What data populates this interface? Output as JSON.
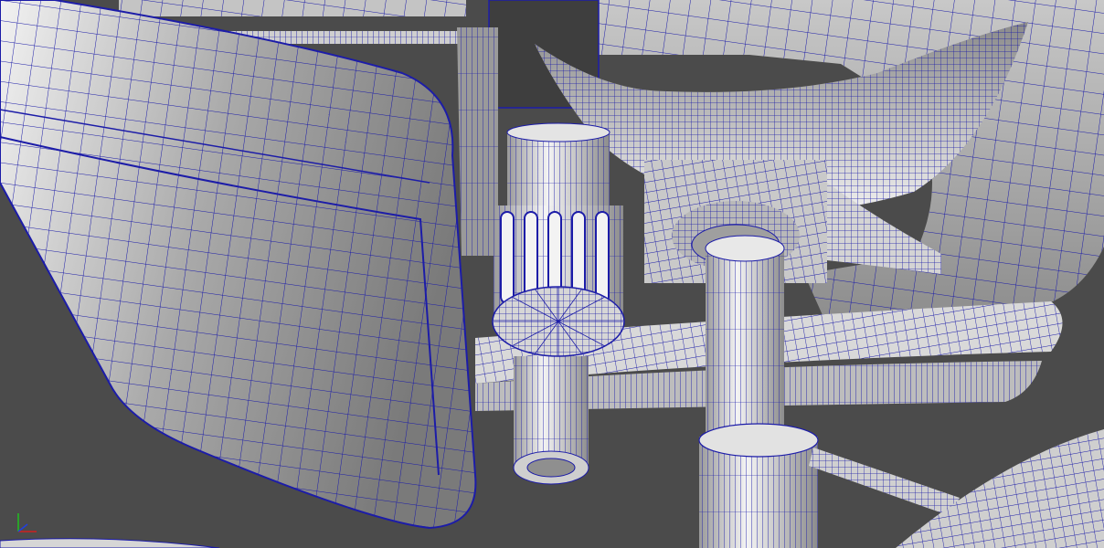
{
  "viewport": {
    "background": "#4b4b4b",
    "shading": "wireframe-on-shaded",
    "wire_color": "#1a1aa8",
    "surface_color": "#d8d8d8"
  },
  "objects": [
    "armrest-pad",
    "gas-lift-cylinder",
    "tilt-knob",
    "seat-mechanism",
    "seat-pan",
    "star-base-leg"
  ],
  "axis_gizmo": {
    "icon": "view-axis-icon",
    "colors": {
      "x": "#d02020",
      "y": "#20c020",
      "z": "#2040e0"
    }
  }
}
